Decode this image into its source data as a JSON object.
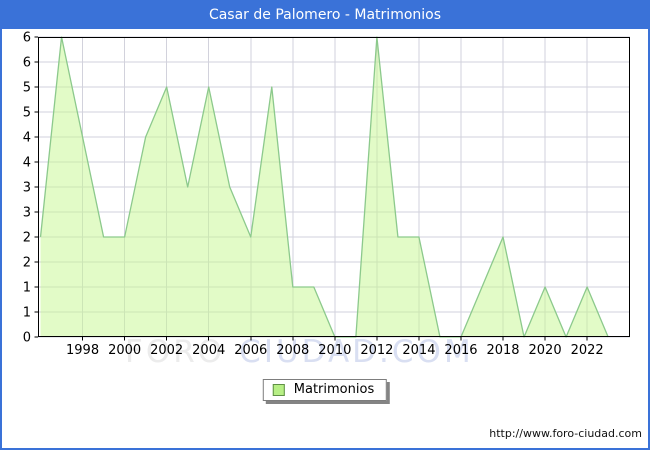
{
  "window": {
    "title": "Casar de Palomero - Matrimonios"
  },
  "watermark": {
    "part1": "FORO",
    "part2": "CIUDAD.COM"
  },
  "legend": {
    "label": "Matrimonios",
    "swatch_color": "#b7ef85"
  },
  "footer": {
    "url": "http://www.foro-ciudad.com"
  },
  "colors": {
    "accent_blue": "#3a72d8",
    "plot_frame": "#000000",
    "gridline": "#d2d2dc",
    "area_fill": "#c7f793",
    "area_line": "#8cc98c",
    "watermark_gray": "#ececec",
    "watermark_blue": "#d9dff2"
  },
  "chart_data": {
    "type": "area",
    "title": "Casar de Palomero - Matrimonios",
    "series_name": "Matrimonios",
    "x": [
      1996,
      1997,
      1998,
      1999,
      2000,
      2001,
      2002,
      2003,
      2004,
      2005,
      2006,
      2007,
      2008,
      2009,
      2010,
      2011,
      2012,
      2013,
      2014,
      2015,
      2016,
      2017,
      2018,
      2019,
      2020,
      2021,
      2022,
      2023
    ],
    "values": [
      2,
      6,
      4,
      2,
      2,
      4,
      5,
      3,
      5,
      3,
      2,
      5,
      1,
      1,
      0,
      0,
      6,
      2,
      2,
      0,
      0,
      1,
      2,
      0,
      1,
      0,
      1,
      0
    ],
    "ylim": [
      0,
      6
    ],
    "y_grid_step": 0.5,
    "x_domain": [
      1995.88,
      2024.04
    ],
    "x_tick_years": [
      1998,
      2000,
      2002,
      2004,
      2006,
      2008,
      2010,
      2012,
      2014,
      2016,
      2018,
      2020,
      2022
    ],
    "y_tick_labels_top_to_bottom": [
      "6",
      "6",
      "5",
      "5",
      "4",
      "4",
      "3",
      "3",
      "2",
      "2",
      "1",
      "1",
      "0"
    ],
    "grid": true,
    "legend_position": "bottom-center",
    "fill_color": "#c7f793",
    "fill_opacity": 0.52,
    "line_color": "#8cc98c"
  }
}
